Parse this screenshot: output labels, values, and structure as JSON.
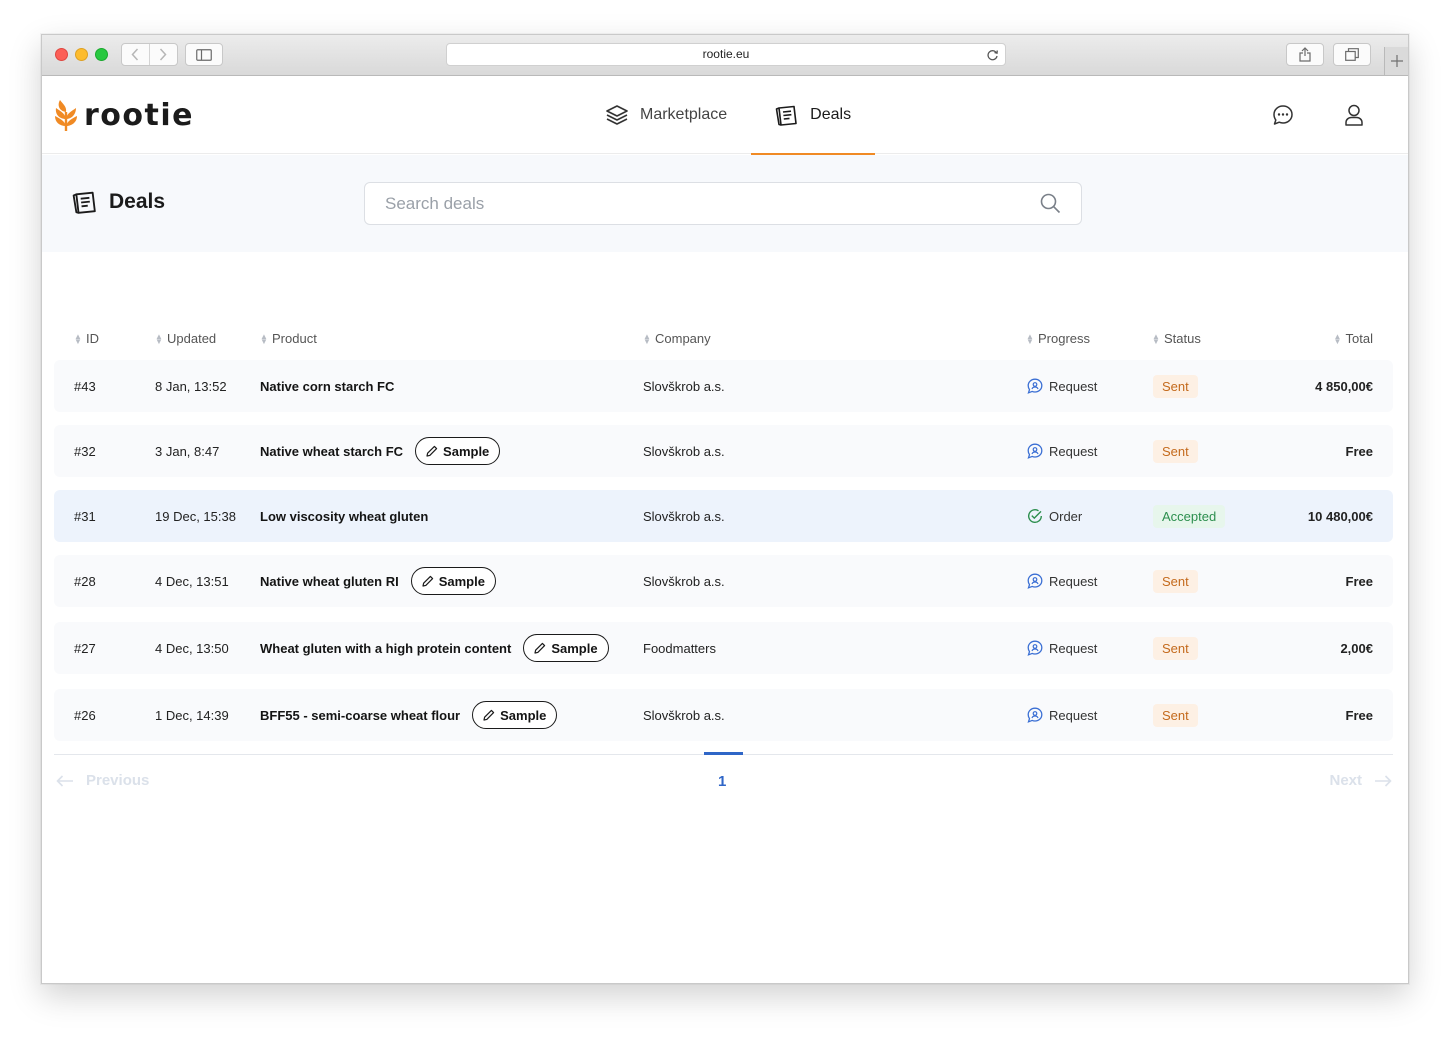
{
  "browser": {
    "url": "rootie.eu"
  },
  "brand": {
    "name": "rootie",
    "accent": "#f08a24"
  },
  "nav": {
    "items": [
      {
        "label": "Marketplace",
        "icon": "layers-icon",
        "active": false
      },
      {
        "label": "Deals",
        "icon": "deals-icon",
        "active": true
      }
    ],
    "right_icons": [
      "chat-icon",
      "user-icon"
    ]
  },
  "page": {
    "title": "Deals",
    "search_placeholder": "Search deals"
  },
  "table": {
    "columns": [
      "ID",
      "Updated",
      "Product",
      "Company",
      "Progress",
      "Status",
      "Total"
    ],
    "rows": [
      {
        "id": "#43",
        "updated": "8 Jan, 13:52",
        "product": "Native corn starch FC",
        "sample": null,
        "company": "Slovškrob a.s.",
        "progress": "Request",
        "status": "Sent",
        "total": "4 850,00€",
        "highlight": false
      },
      {
        "id": "#32",
        "updated": "3 Jan, 8:47",
        "product": "Native wheat starch FC",
        "sample": "Sample",
        "company": "Slovškrob a.s.",
        "progress": "Request",
        "status": "Sent",
        "total": "Free",
        "highlight": false
      },
      {
        "id": "#31",
        "updated": "19 Dec, 15:38",
        "product": "Low viscosity wheat gluten",
        "sample": null,
        "company": "Slovškrob a.s.",
        "progress": "Order",
        "status": "Accepted",
        "total": "10 480,00€",
        "highlight": true
      },
      {
        "id": "#28",
        "updated": "4 Dec, 13:51",
        "product": "Native wheat gluten RI",
        "sample": "Sample",
        "company": "Slovškrob a.s.",
        "progress": "Request",
        "status": "Sent",
        "total": "Free",
        "highlight": false
      },
      {
        "id": "#27",
        "updated": "4 Dec, 13:50",
        "product": "Wheat gluten with a high protein content",
        "sample": "Sample",
        "company": "Foodmatters",
        "progress": "Request",
        "status": "Sent",
        "total": "2,00€",
        "highlight": false
      },
      {
        "id": "#26",
        "updated": "1 Dec, 14:39",
        "product": "BFF55 - semi-coarse wheat flour",
        "sample": "Sample",
        "company": "Slovškrob a.s.",
        "progress": "Request",
        "status": "Sent",
        "total": "Free",
        "highlight": false
      }
    ]
  },
  "pagination": {
    "previous": "Previous",
    "next": "Next",
    "current_page": "1"
  },
  "colors": {
    "sent_bg": "#fdf0e4",
    "sent_text": "#c46a1c",
    "accepted_bg": "#e7f6ec",
    "accepted_text": "#2d8f4e",
    "link_blue": "#2f66c7"
  }
}
